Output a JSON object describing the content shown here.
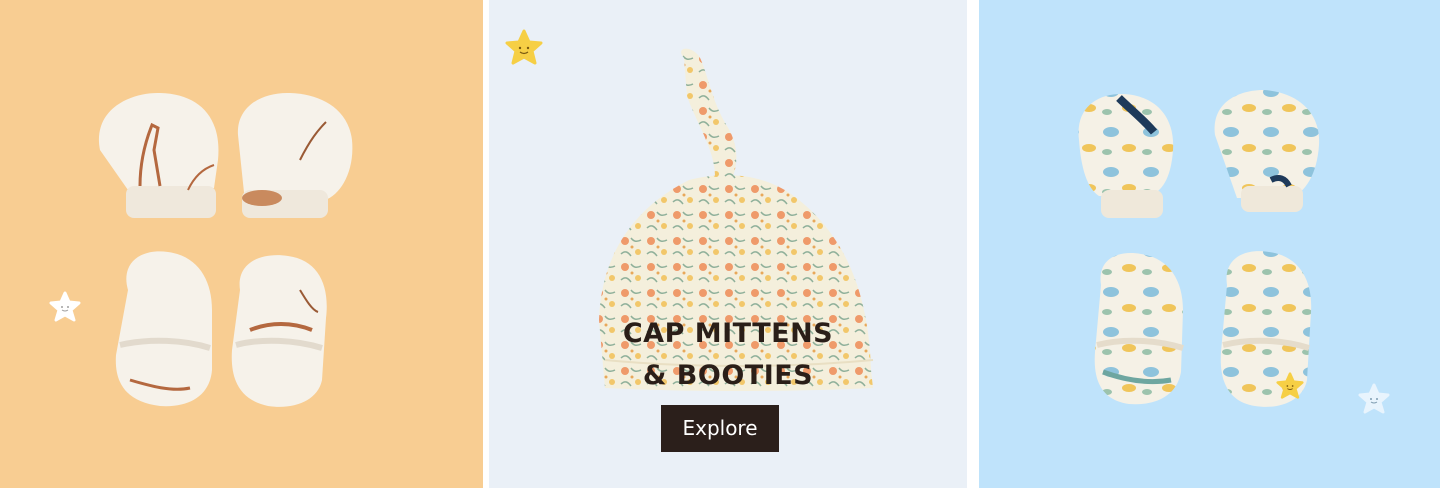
{
  "banner": {
    "title_line1": "CAP MITTENS",
    "title_line2": "& BOOTIES",
    "cta_label": "Explore"
  },
  "panels": [
    {
      "product": "mittens-and-booties",
      "print": "giraffe"
    },
    {
      "product": "knot-cap",
      "print": "floral"
    },
    {
      "product": "mittens-and-booties",
      "print": "dinosaur"
    }
  ],
  "colors": {
    "left_bg": "#f8cd92",
    "middle_bg": "#eaf0f7",
    "right_bg": "#bfe3fb",
    "cta_bg": "#2b1f1b",
    "title_text": "#2a1e18",
    "star_yellow": "#f6cf45",
    "star_white": "#ffffff"
  },
  "icons": [
    "smiling-star-icon"
  ]
}
